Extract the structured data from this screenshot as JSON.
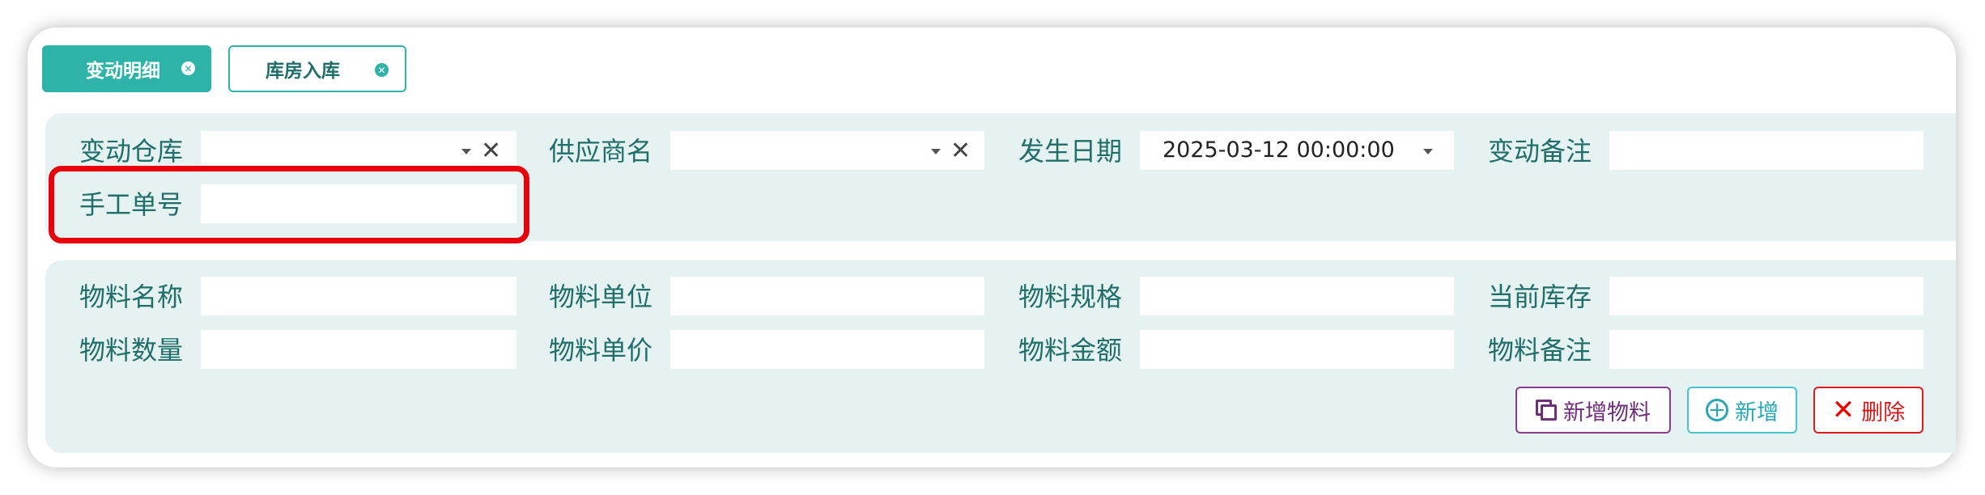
{
  "tabs": [
    {
      "label": "变动明细",
      "active": true,
      "close_icon": "close-circle-icon"
    },
    {
      "label": "库房入库",
      "active": false,
      "close_icon": "close-circle-icon"
    }
  ],
  "header_form": {
    "warehouse": {
      "label": "变动仓库",
      "value": "",
      "arrow_icon": "caret-down-icon",
      "clear_icon": "close-icon"
    },
    "supplier": {
      "label": "供应商名",
      "value": "",
      "arrow_icon": "caret-down-icon",
      "clear_icon": "close-icon"
    },
    "date": {
      "label": "发生日期",
      "value": "2025-03-12 00:00:00",
      "arrow_icon": "caret-down-icon"
    },
    "remark": {
      "label": "变动备注",
      "value": ""
    },
    "manual_no": {
      "label": "手工单号",
      "value": ""
    }
  },
  "material_form": {
    "name": {
      "label": "物料名称",
      "value": ""
    },
    "unit": {
      "label": "物料单位",
      "value": ""
    },
    "spec": {
      "label": "物料规格",
      "value": ""
    },
    "stock": {
      "label": "当前库存",
      "value": ""
    },
    "qty": {
      "label": "物料数量",
      "value": ""
    },
    "price": {
      "label": "物料单价",
      "value": ""
    },
    "amount": {
      "label": "物料金额",
      "value": ""
    },
    "remark": {
      "label": "物料备注",
      "value": ""
    }
  },
  "buttons": {
    "add_material": {
      "label": "新增物料",
      "icon": "copy-icon"
    },
    "add": {
      "label": "新增",
      "icon": "plus-circle-icon"
    },
    "delete": {
      "label": "删除",
      "icon": "x-icon"
    }
  },
  "colors": {
    "accent": "#2db3a8",
    "panel_bg": "#e6f1f1",
    "label_text": "#1f6f68",
    "highlight": "#e8000b"
  }
}
